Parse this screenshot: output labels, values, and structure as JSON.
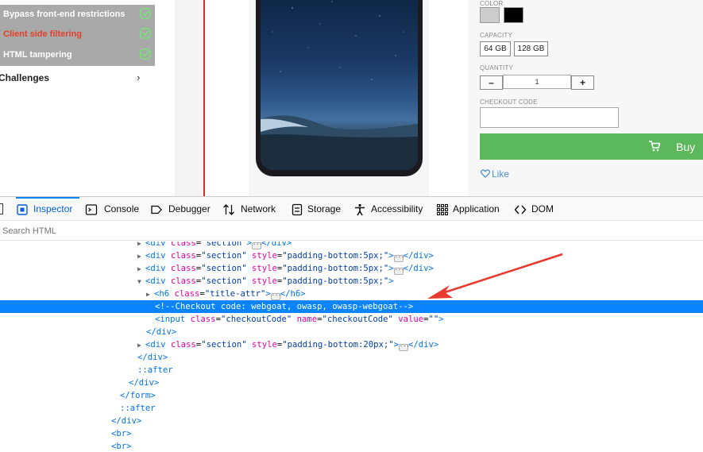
{
  "sidebar": {
    "items": [
      {
        "label": "Bypass front-end restrictions",
        "active": false
      },
      {
        "label": "Client side filtering",
        "active": true
      },
      {
        "label": "HTML tampering",
        "active": false
      }
    ],
    "challenges_label": "Challenges",
    "challenges_arrow": "›"
  },
  "product": {
    "color_label": "COLOR",
    "colors": [
      "#cccccc",
      "#000000"
    ],
    "capacity_label": "CAPACITY",
    "capacities": [
      "64 GB",
      "128 GB"
    ],
    "quantity_label": "QUANTITY",
    "quantity_minus": "–",
    "quantity_value": "1",
    "quantity_plus": "+",
    "checkout_label": "CHECKOUT CODE",
    "checkout_value": "",
    "buy_label": "Buy",
    "like_label": "Like"
  },
  "devtools": {
    "tabs": [
      {
        "label": "Inspector",
        "icon": "inspector-icon",
        "selected": true
      },
      {
        "label": "Console",
        "icon": "console-icon"
      },
      {
        "label": "Debugger",
        "icon": "debugger-icon"
      },
      {
        "label": "Network",
        "icon": "network-icon"
      },
      {
        "label": "Storage",
        "icon": "storage-icon"
      },
      {
        "label": "Accessibility",
        "icon": "accessibility-icon"
      },
      {
        "label": "Application",
        "icon": "application-icon"
      },
      {
        "label": "DOM",
        "icon": "dom-icon"
      }
    ],
    "search_placeholder": "Search HTML",
    "tree": {
      "r1": {
        "tag": "div",
        "attr1": "class",
        "val1": "\"section\""
      },
      "r2": {
        "tag": "div",
        "attr1": "class",
        "val1": "\"section\"",
        "attr2": "style",
        "val2": "\"padding-bottom:5px;\""
      },
      "r3": {
        "tag": "div",
        "attr1": "class",
        "val1": "\"section\"",
        "attr2": "style",
        "val2": "\"padding-bottom:5px;\""
      },
      "r4": {
        "tag": "div",
        "attr1": "class",
        "val1": "\"section\"",
        "attr2": "style",
        "val2": "\"padding-bottom:5px;\""
      },
      "r5": {
        "tag": "h6",
        "attr1": "class",
        "val1": "\"title-attr\""
      },
      "r6": {
        "comment": "<!--Checkout code: webgoat, owasp, owasp-webgoat-->"
      },
      "r7": {
        "tag": "input",
        "attr1": "class",
        "val1": "\"checkoutCode\"",
        "attr2": "name",
        "val2": "\"checkoutCode\"",
        "attr3": "value",
        "val3": "\"\""
      },
      "r8": {
        "close": "div"
      },
      "r9": {
        "tag": "div",
        "attr1": "class",
        "val1": "\"section\"",
        "attr2": "style",
        "val2": "\"padding-bottom:20px;\""
      },
      "r10": {
        "close": "div"
      },
      "r11": {
        "pseudo": "::after"
      },
      "r12": {
        "close": "div"
      },
      "r13": {
        "close": "form"
      },
      "r14": {
        "pseudo": "::after"
      },
      "r15": {
        "close": "div"
      },
      "r16": {
        "tag": "br"
      },
      "r17": {
        "tag": "br"
      }
    }
  },
  "colors": {
    "highlight": "#0a84ff",
    "buy_green": "#5cb85c",
    "sidebar_grey": "#a9a9a9",
    "active_red": "#e2402e",
    "annotation_arrow": "#e8392f"
  }
}
